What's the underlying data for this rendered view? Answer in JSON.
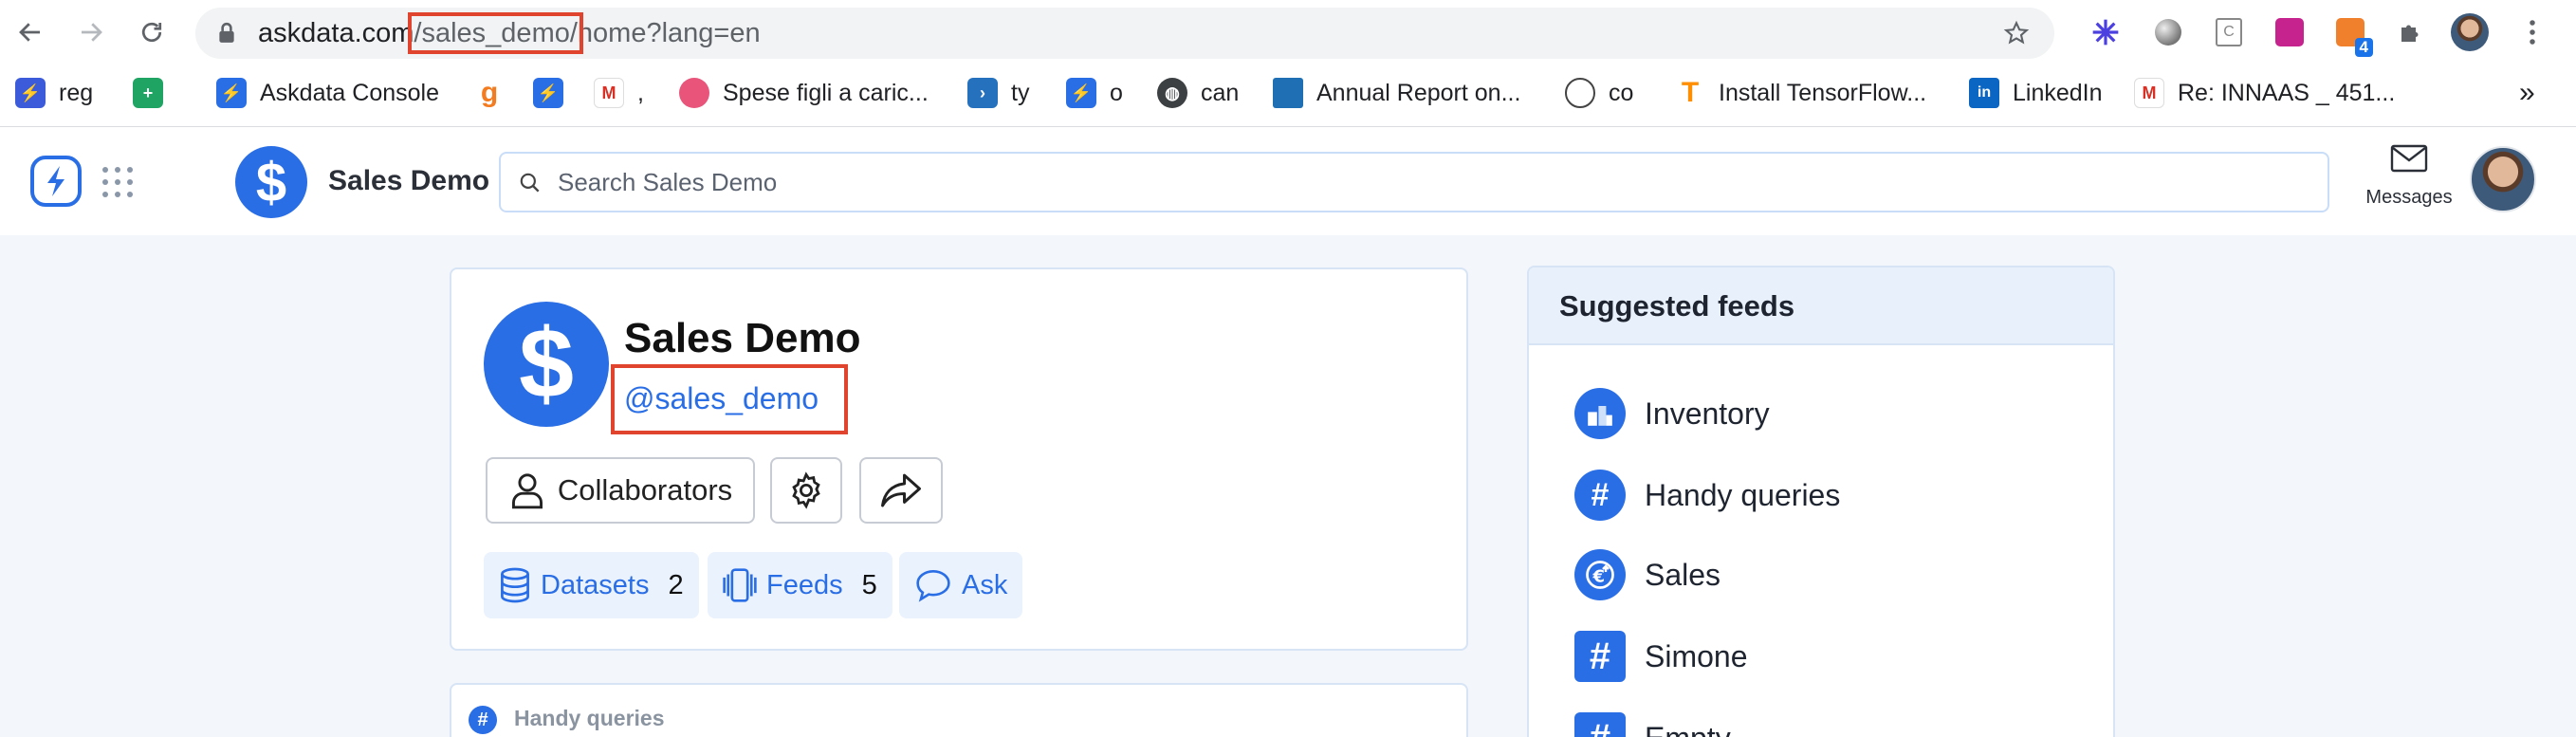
{
  "browser": {
    "url_host": "askdata.com",
    "url_path_highlight": "/sales_demo/",
    "url_rest": "home?lang=en",
    "extension_badge": "4",
    "bookmarks": [
      {
        "label": "reg",
        "icon": "askdata-icon"
      },
      {
        "label": "",
        "icon": "google-sheets-icon"
      },
      {
        "label": "Askdata Console",
        "icon": "askdata-icon"
      },
      {
        "label": "",
        "icon": "g-orange-icon"
      },
      {
        "label": "",
        "icon": "askdata-icon"
      },
      {
        "label": ",",
        "icon": "gmail-icon"
      },
      {
        "label": "Spese figli a caric...",
        "icon": "pink-circle-icon"
      },
      {
        "label": "ty",
        "icon": "powershell-icon"
      },
      {
        "label": "o",
        "icon": "askdata-icon"
      },
      {
        "label": "can",
        "icon": "globe-icon"
      },
      {
        "label": "Annual Report on...",
        "icon": "report-icon"
      },
      {
        "label": "co",
        "icon": "egg-icon"
      },
      {
        "label": "Install TensorFlow...",
        "icon": "tensorflow-icon"
      },
      {
        "label": "LinkedIn",
        "icon": "linkedin-icon"
      },
      {
        "label": "Re: INNAAS _ 451...",
        "icon": "gmail-icon"
      }
    ],
    "bookmarks_overflow": "»"
  },
  "header": {
    "space_name": "Sales Demo",
    "search_placeholder": "Search Sales Demo",
    "messages_label": "Messages"
  },
  "profile": {
    "logo_symbol": "$",
    "title": "Sales Demo",
    "handle": "@sales_demo",
    "collaborators_label": "Collaborators",
    "datasets_label": "Datasets",
    "datasets_count": "2",
    "feeds_label": "Feeds",
    "feeds_count": "5",
    "ask_label": "Ask"
  },
  "handy_card": {
    "icon_symbol": "#",
    "label": "Handy queries"
  },
  "suggested_feeds": {
    "title": "Suggested feeds",
    "items": [
      {
        "label": "Inventory",
        "icon": "inventory-icon"
      },
      {
        "label": "Handy queries",
        "icon": "hashtag-round-icon"
      },
      {
        "label": "Sales",
        "icon": "euro-up-icon"
      },
      {
        "label": "Simone",
        "icon": "hashtag-square-icon"
      },
      {
        "label": "Empty",
        "icon": "hashtag-square-icon"
      }
    ]
  },
  "colors": {
    "brand_blue": "#2a6ee6",
    "highlight_red": "#e0442f",
    "page_bg": "#f3f6fb"
  }
}
